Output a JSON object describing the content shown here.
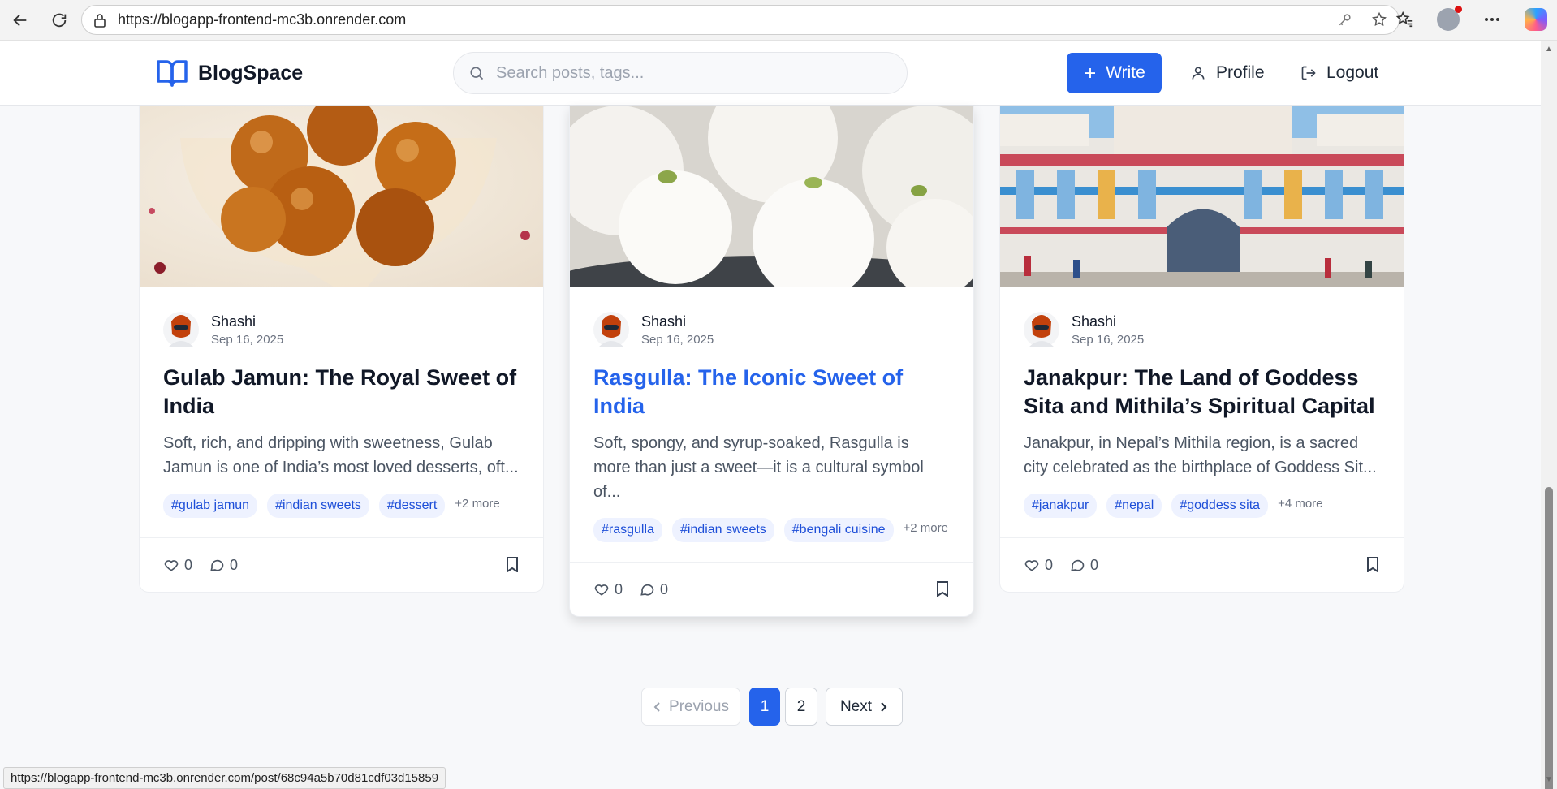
{
  "browser": {
    "url": "https://blogapp-frontend-mc3b.onrender.com",
    "status_url": "https://blogapp-frontend-mc3b.onrender.com/post/68c94a5b70d81cdf03d15859"
  },
  "header": {
    "brand": "BlogSpace",
    "search_placeholder": "Search posts, tags...",
    "write_label": "Write",
    "profile_label": "Profile",
    "logout_label": "Logout",
    "accent_color": "#2563eb"
  },
  "posts": [
    {
      "author": "Shashi",
      "date": "Sep 16, 2025",
      "title": "Gulab Jamun: The Royal Sweet of India",
      "excerpt": "Soft, rich, and dripping with sweetness, Gulab Jamun is one of India’s most loved desserts, oft...",
      "tags": [
        "#gulab jamun",
        "#indian sweets",
        "#dessert"
      ],
      "more": "+2 more",
      "likes": "0",
      "comments": "0"
    },
    {
      "author": "Shashi",
      "date": "Sep 16, 2025",
      "title": "Rasgulla: The Iconic Sweet of India",
      "excerpt": "Soft, spongy, and syrup-soaked, Rasgulla is more than just a sweet—it is a cultural symbol of...",
      "tags": [
        "#rasgulla",
        "#indian sweets",
        "#bengali cuisine"
      ],
      "more": "+2 more",
      "likes": "0",
      "comments": "0"
    },
    {
      "author": "Shashi",
      "date": "Sep 16, 2025",
      "title": "Janakpur: The Land of Goddess Sita and Mithila’s Spiritual Capital",
      "excerpt": "Janakpur, in Nepal’s Mithila region, is a sacred city celebrated as the birthplace of Goddess Sit...",
      "tags": [
        "#janakpur",
        "#nepal",
        "#goddess sita"
      ],
      "more": "+4 more",
      "likes": "0",
      "comments": "0"
    }
  ],
  "pagination": {
    "previous": "Previous",
    "pages": [
      "1",
      "2"
    ],
    "current": "1",
    "next": "Next"
  }
}
